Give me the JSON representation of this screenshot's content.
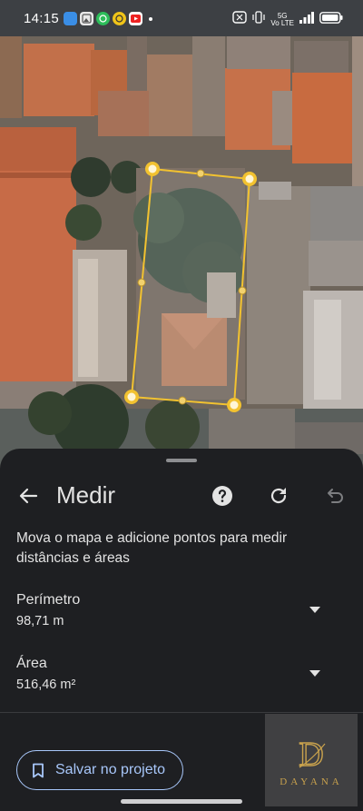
{
  "status_bar": {
    "time": "14:15",
    "notifications": [
      "blue-app-icon",
      "gallery-icon",
      "whatsapp-icon",
      "whatsapp-business-icon",
      "youtube-icon",
      "dot-icon"
    ],
    "network_top": "5G",
    "network_bottom": "Vo LTE",
    "icons": [
      "nfc-icon",
      "vibrate-icon",
      "signal-icon",
      "battery-icon"
    ]
  },
  "map": {
    "measure_outline_color": "#f2c230",
    "vertex_icon": "vertex-handle-icon",
    "midpoint_icon": "midpoint-handle-icon"
  },
  "sheet": {
    "title": "Medir",
    "instructions": "Mova o mapa e adicione pontos para medir distâncias e áreas",
    "metrics": [
      {
        "label": "Perímetro",
        "value": "98,71 m"
      },
      {
        "label": "Área",
        "value": "516,46 m²"
      }
    ],
    "save_button": {
      "label": "Salvar no projeto",
      "icon": "bookmark-icon"
    },
    "accent_color": "#a8c7fa"
  },
  "watermark": {
    "monogram": "D",
    "text": "DAYANA",
    "color": "#c9a24d"
  }
}
